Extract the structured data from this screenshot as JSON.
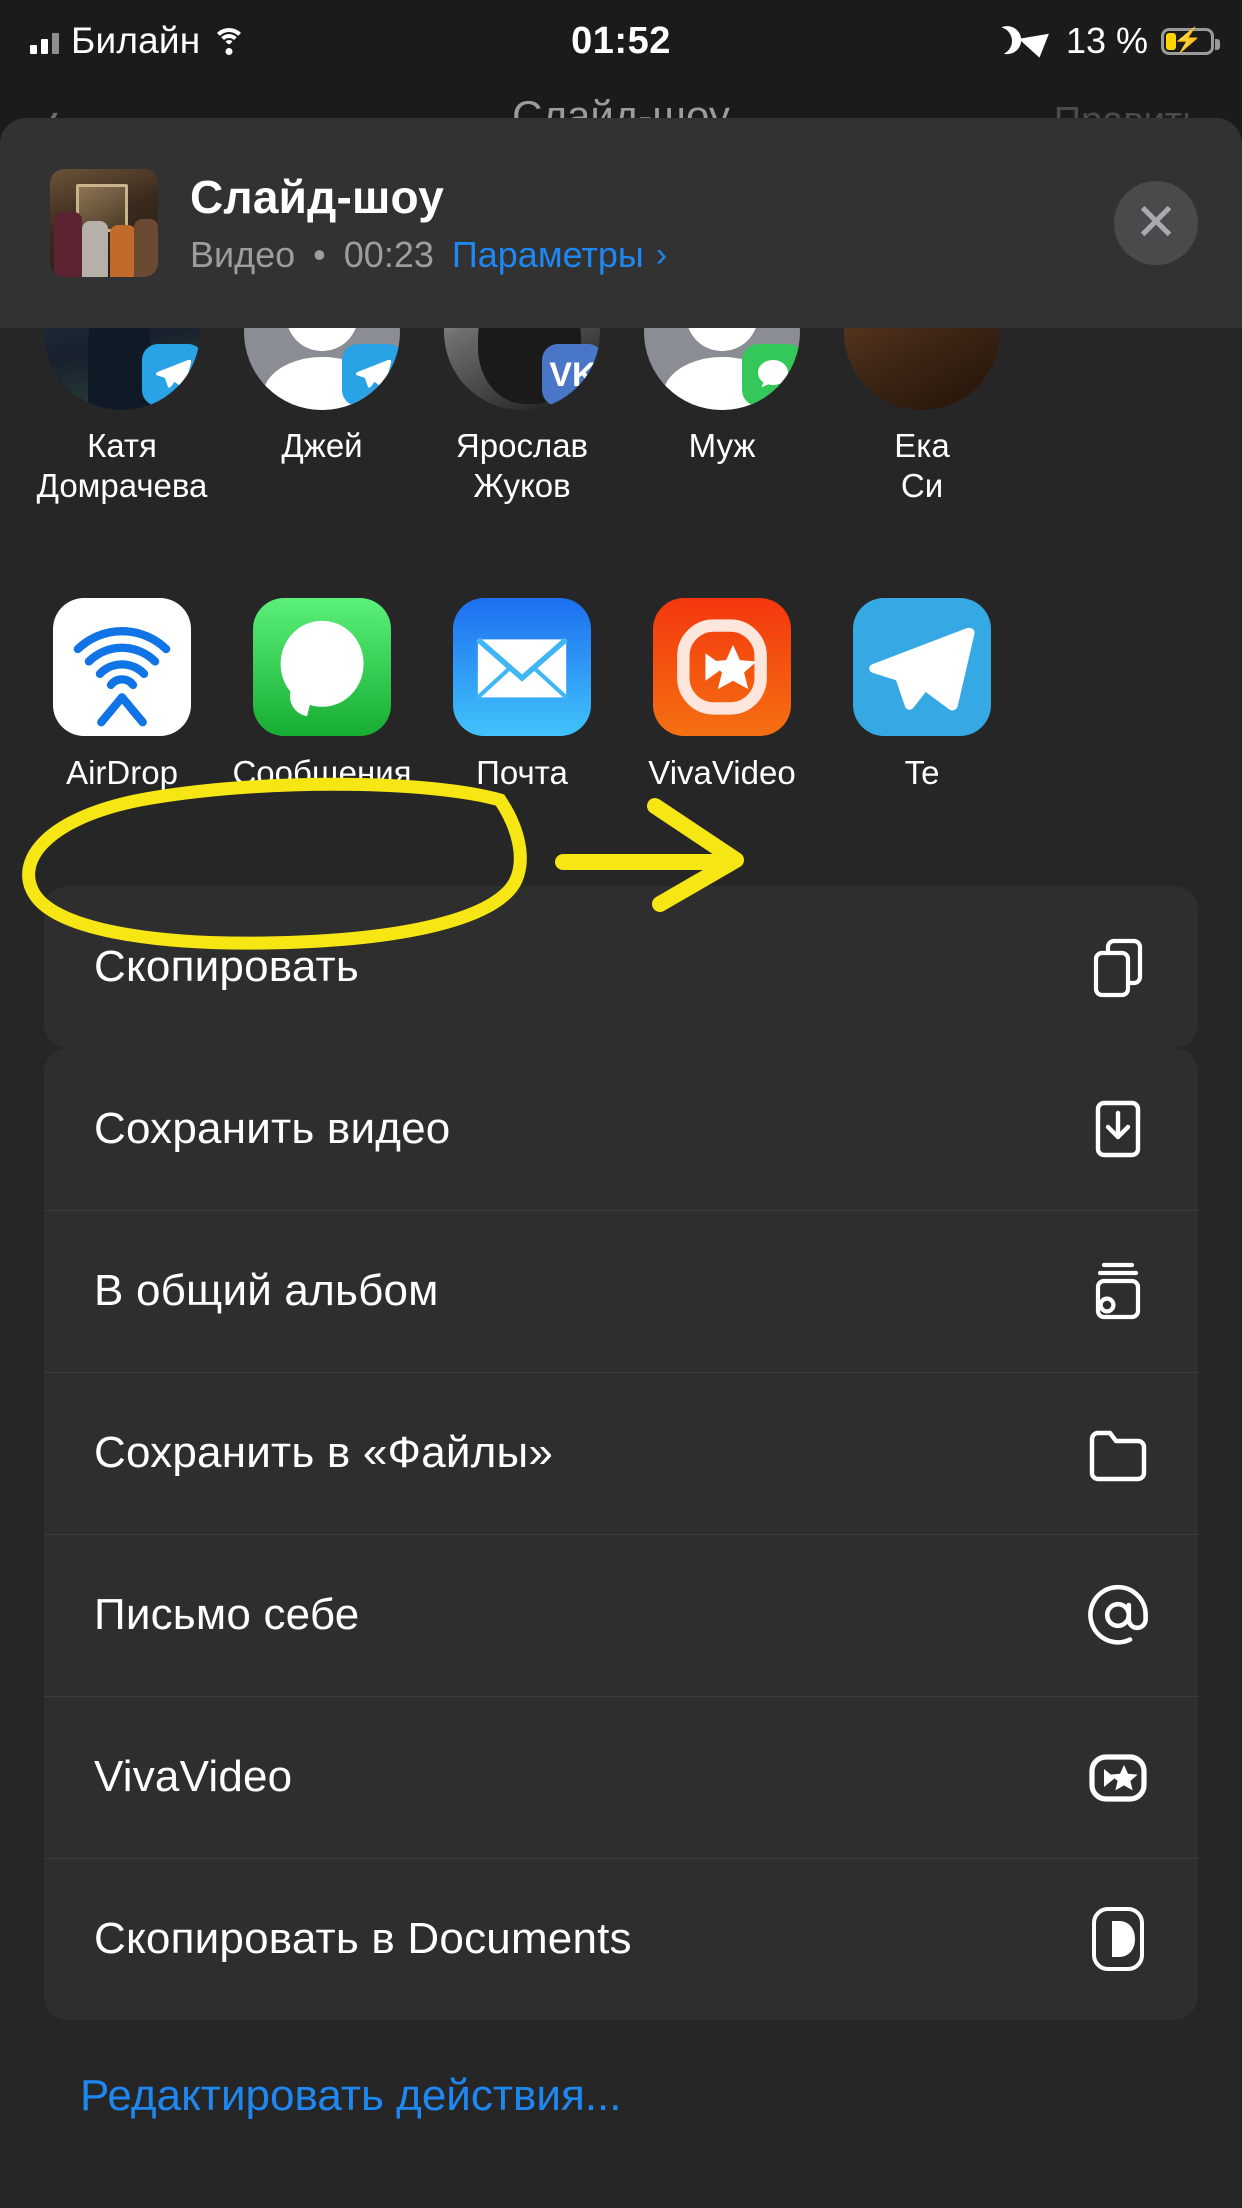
{
  "status_bar": {
    "signal_icon": "signal-bars-icon",
    "carrier": "Билайн",
    "wifi_icon": "wifi-icon",
    "time": "01:52",
    "dnd_icon": "moon-icon",
    "location_icon": "location-arrow-icon",
    "battery_percent": "13 %",
    "battery_icon": "battery-charging-icon"
  },
  "background_app": {
    "back_icon": "chevron-left-icon",
    "title": "Слайд-шоу",
    "edit_label": "Править"
  },
  "share_sheet": {
    "header": {
      "thumbnail": "video-thumbnail",
      "title": "Слайд-шоу",
      "kind": "Видео",
      "separator": "•",
      "duration": "00:23",
      "options_label": "Параметры",
      "options_chevron": "chevron-right-icon",
      "close_label": "✕"
    },
    "contacts": [
      {
        "name_line1": "Катя",
        "name_line2": "Домрачева",
        "badge": "telegram-icon",
        "avatar": "photo-avatar"
      },
      {
        "name_line1": "Джей",
        "name_line2": "",
        "badge": "telegram-icon",
        "avatar": "person-avatar"
      },
      {
        "name_line1": "Ярослав",
        "name_line2": "Жуков",
        "badge": "vk-icon",
        "avatar": "photo-avatar"
      },
      {
        "name_line1": "Муж",
        "name_line2": "",
        "badge": "messages-icon",
        "avatar": "person-avatar"
      },
      {
        "name_line1": "Ека",
        "name_line2": "Си",
        "badge": "",
        "avatar": "photo-avatar"
      }
    ],
    "apps": [
      {
        "label": "AirDrop",
        "icon": "airdrop-icon"
      },
      {
        "label": "Сообщения",
        "icon": "messages-app-icon"
      },
      {
        "label": "Почта",
        "icon": "mail-app-icon"
      },
      {
        "label": "VivaVideo",
        "icon": "vivavideo-app-icon"
      },
      {
        "label": "Te",
        "icon": "telegram-app-icon"
      }
    ],
    "actions_group_1": [
      {
        "label": "Скопировать",
        "icon": "copy-icon"
      }
    ],
    "actions_group_2": [
      {
        "label": "Сохранить видео",
        "icon": "download-icon"
      },
      {
        "label": "В общий альбом",
        "icon": "shared-album-icon"
      },
      {
        "label": "Сохранить в «Файлы»",
        "icon": "folder-icon"
      },
      {
        "label": "Письмо себе",
        "icon": "at-sign-icon"
      },
      {
        "label": "VivaVideo",
        "icon": "vivavideo-icon"
      },
      {
        "label": "Скопировать в Documents",
        "icon": "documents-icon"
      }
    ],
    "edit_actions_label": "Редактировать действия..."
  },
  "annotation": {
    "color": "#f5e614",
    "shapes": [
      "ellipse-highlight",
      "arrow-pointing-right"
    ],
    "target": "Сохранить видео"
  },
  "colors": {
    "accent_blue": "#1f87f2",
    "sheet_bg": "#262626",
    "row_bg": "#2e2e2e",
    "header_bg": "#323232",
    "annotation_yellow": "#f5e614",
    "battery_yellow": "#ffd400"
  }
}
